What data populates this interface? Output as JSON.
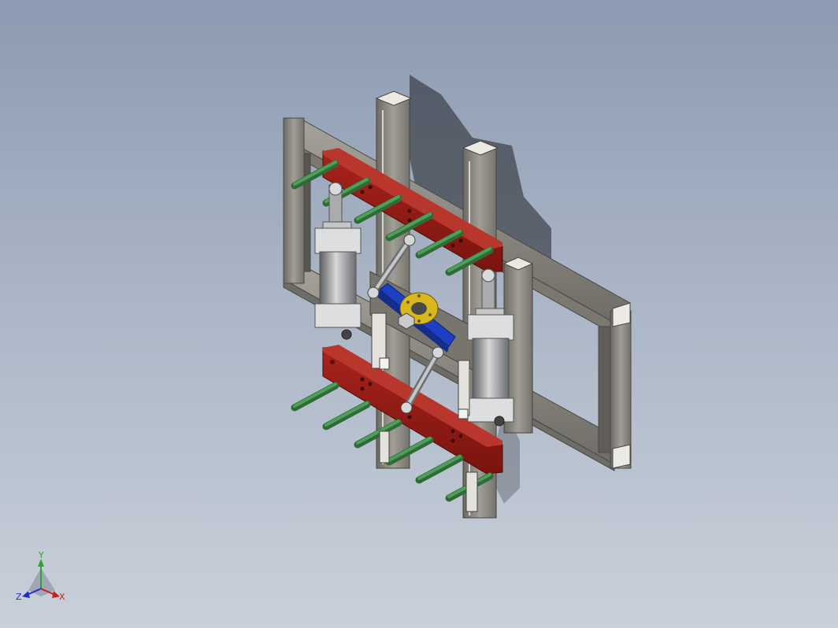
{
  "viewport": {
    "background_top": "#8c9bb2",
    "background_bottom": "#c9d0da"
  },
  "model": {
    "frame_color": "#8a877f",
    "plate_color": "#8f1a14",
    "pin_color": "#3e8a48",
    "link_color": "#1d3fc4",
    "hub_color": "#d8b81e",
    "cylinder_color": "#b7b9bb"
  },
  "triad": {
    "x_label": "X",
    "y_label": "Y",
    "z_label": "Z",
    "x_color": "#c81e1e",
    "y_color": "#2aa62a",
    "z_color": "#1e2fc8"
  }
}
